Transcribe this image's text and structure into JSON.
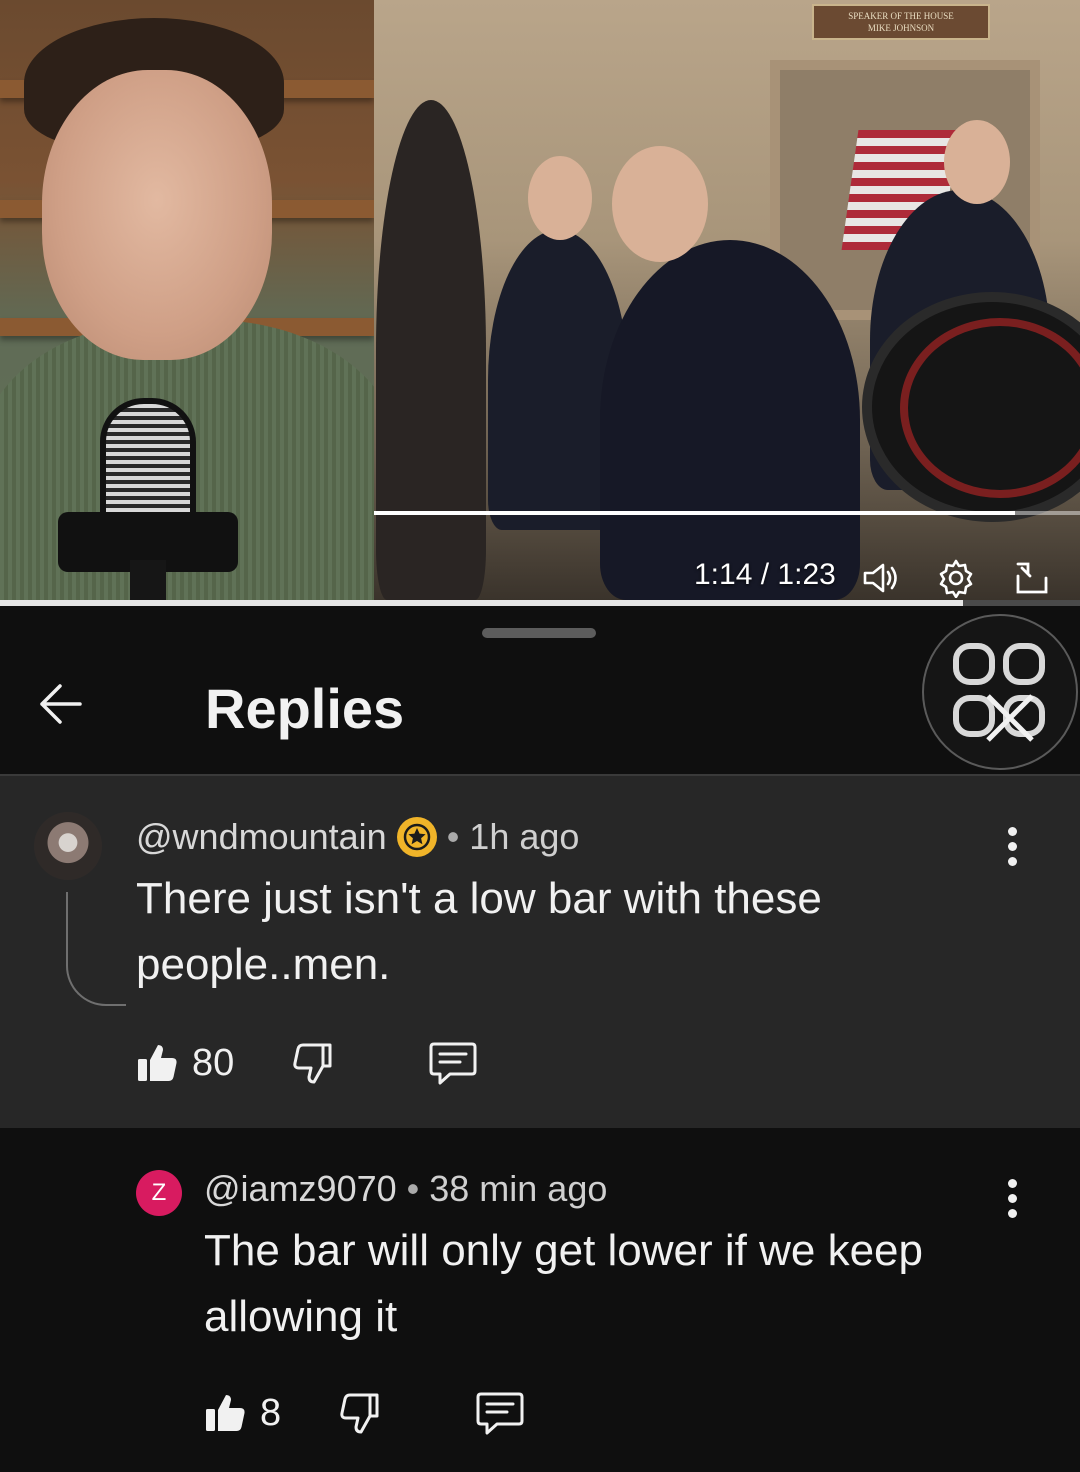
{
  "player": {
    "current_time": "1:14",
    "separator": "/",
    "duration": "1:23",
    "progress": 0.892,
    "scrub_progress": 0.908,
    "sign_text": "SPEAKER OF THE HOUSE MIKE JOHNSON"
  },
  "panel": {
    "title": "Replies",
    "back_icon": "arrow-left-icon",
    "pip_icon": "miniplayer-close-icon"
  },
  "comments": [
    {
      "author": "@wndmountain",
      "badge_icon": "star-badge-icon",
      "separator": "•",
      "time": "1h ago",
      "text_line1": "There just isn't a low bar with these",
      "text_line2": "people..men.",
      "likes": "80"
    },
    {
      "author": "@iamz9070",
      "avatar_letter": "Z",
      "separator": "•",
      "time": "38 min ago",
      "text_line1": "The bar will only get lower if we keep",
      "text_line2": "allowing it",
      "likes": "8"
    }
  ],
  "colors": {
    "reply_avatar": "#d81b60",
    "badge": "#f0b429",
    "panel_bg": "#0f0f0f",
    "highlight_bg": "#272727"
  }
}
